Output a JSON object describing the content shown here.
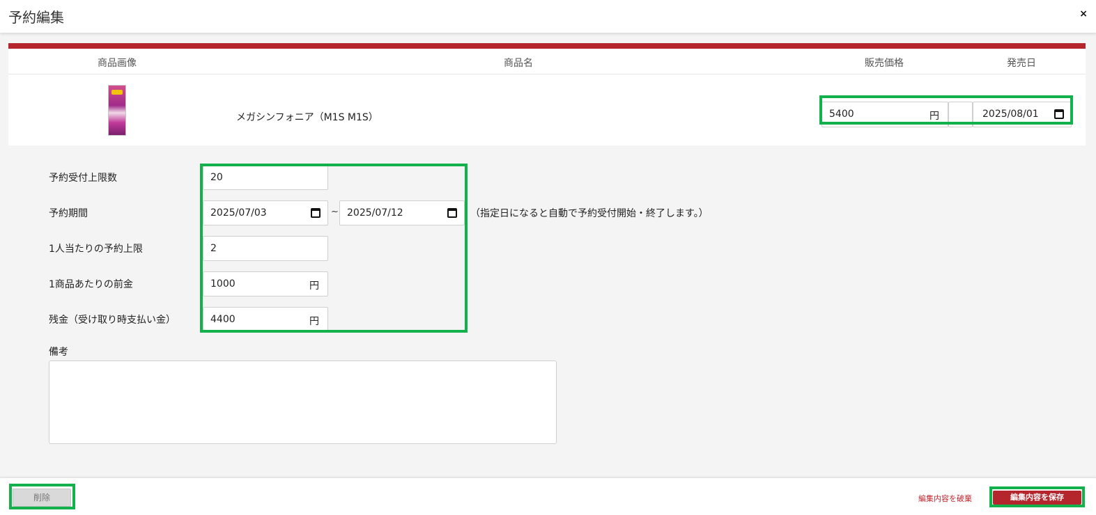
{
  "header": {
    "title": "予約編集",
    "close_label": "×"
  },
  "product_table": {
    "columns": [
      "商品画像",
      "商品名",
      "販売価格",
      "発売日"
    ],
    "row": {
      "image_icon": "booster-pack-image",
      "name": "メガシンフォニア（M1S M1S）",
      "price": "5400",
      "price_unit": "円",
      "release_date": "2025/08/01"
    }
  },
  "form": {
    "limit": {
      "label": "予約受付上限数",
      "value": "20"
    },
    "period": {
      "label": "予約期間",
      "start": "2025/07/03",
      "separator": "~",
      "end": "2025/07/12",
      "note": "（指定日になると自動で予約受付開始・終了します。）"
    },
    "per_person": {
      "label": "1人当たりの予約上限",
      "value": "2"
    },
    "deposit": {
      "label": "1商品あたりの前金",
      "value": "1000",
      "unit": "円"
    },
    "balance": {
      "label": "残金（受け取り時支払い金）",
      "value": "4400",
      "unit": "円"
    },
    "remarks": {
      "label": "備考",
      "value": ""
    }
  },
  "footer": {
    "delete_label": "削除",
    "discard_label": "編集内容を破棄",
    "save_label": "編集内容を保存"
  },
  "colors": {
    "accent": "#b5262c",
    "highlight": "#12b14c"
  }
}
